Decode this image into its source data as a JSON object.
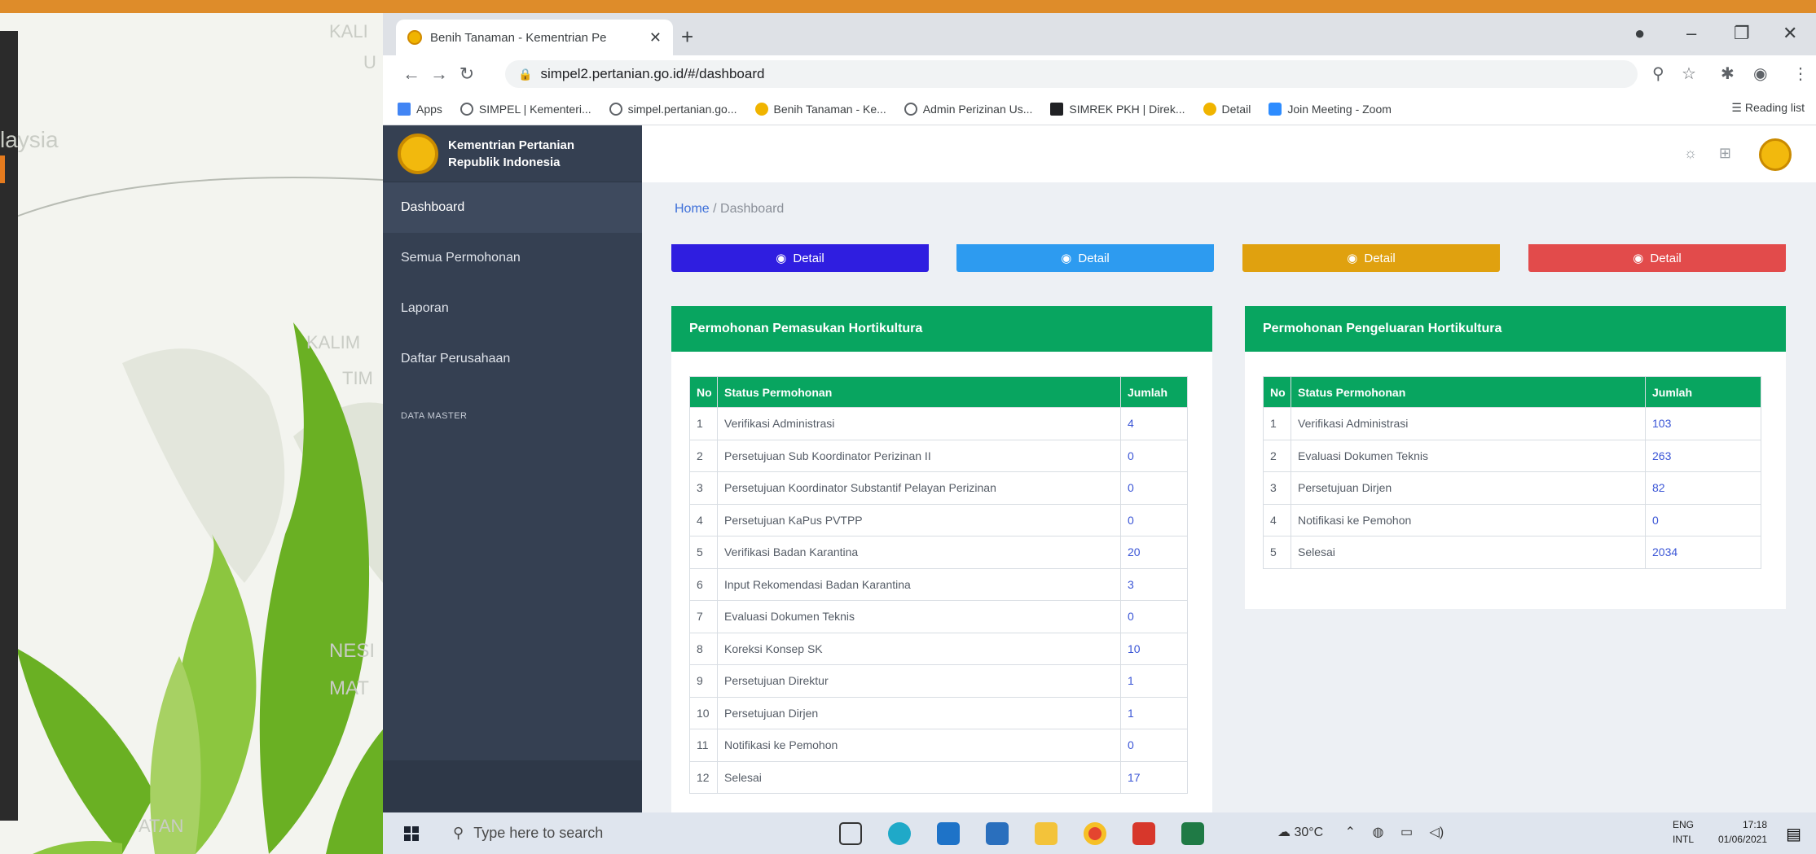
{
  "background": {
    "map_labels": [
      "laysia",
      "KALIM",
      "TIM",
      "NESI",
      "MAT",
      "ATAN",
      "KALI",
      "U"
    ]
  },
  "browser": {
    "tab_title": "Benih Tanaman - Kementrian Pe",
    "url": "simpel2.pertanian.go.id/#/dashboard",
    "bookmarks": [
      {
        "label": "Apps",
        "color": "#4285f4"
      },
      {
        "label": "SIMPEL | Kementeri...",
        "color": "#9aa0a6"
      },
      {
        "label": "simpel.pertanian.go...",
        "color": "#9aa0a6"
      },
      {
        "label": "Benih Tanaman - Ke...",
        "color": "#f0b400"
      },
      {
        "label": "Admin Perizinan Us...",
        "color": "#9aa0a6"
      },
      {
        "label": "SIMREK PKH | Direk...",
        "color": "#202124"
      },
      {
        "label": "Detail",
        "color": "#f0b400"
      },
      {
        "label": "Join Meeting - Zoom",
        "color": "#2d8cff"
      }
    ],
    "reading_list": "Reading list"
  },
  "app": {
    "brand_line1": "Kementrian Pertanian",
    "brand_line2": "Republik Indonesia",
    "nav": [
      "Dashboard",
      "Semua Permohonan",
      "Laporan",
      "Daftar Perusahaan"
    ],
    "nav_header": "DATA MASTER",
    "breadcrumb_home": "Home",
    "breadcrumb_sep": "/",
    "breadcrumb_current": "Dashboard",
    "detail_label": "Detail",
    "detail_colors": [
      "#2f1ee0",
      "#2d9bf0",
      "#e0a10f",
      "#e24b4b"
    ]
  },
  "card_left": {
    "title": "Permohonan Pemasukan Hortikultura",
    "col_no": "No",
    "col_status": "Status Permohonan",
    "col_jumlah": "Jumlah",
    "rows": [
      {
        "no": "1",
        "status": "Verifikasi Administrasi",
        "jumlah": "4"
      },
      {
        "no": "2",
        "status": "Persetujuan Sub Koordinator Perizinan II",
        "jumlah": "0"
      },
      {
        "no": "3",
        "status": "Persetujuan Koordinator Substantif Pelayan Perizinan",
        "jumlah": "0"
      },
      {
        "no": "4",
        "status": "Persetujuan KaPus PVTPP",
        "jumlah": "0"
      },
      {
        "no": "5",
        "status": "Verifikasi Badan Karantina",
        "jumlah": "20"
      },
      {
        "no": "6",
        "status": "Input Rekomendasi Badan Karantina",
        "jumlah": "3"
      },
      {
        "no": "7",
        "status": "Evaluasi Dokumen Teknis",
        "jumlah": "0"
      },
      {
        "no": "8",
        "status": "Koreksi Konsep SK",
        "jumlah": "10"
      },
      {
        "no": "9",
        "status": "Persetujuan Direktur",
        "jumlah": "1"
      },
      {
        "no": "10",
        "status": "Persetujuan Dirjen",
        "jumlah": "1"
      },
      {
        "no": "11",
        "status": "Notifikasi ke Pemohon",
        "jumlah": "0"
      },
      {
        "no": "12",
        "status": "Selesai",
        "jumlah": "17"
      }
    ]
  },
  "card_right": {
    "title": "Permohonan Pengeluaran Hortikultura",
    "col_no": "No",
    "col_status": "Status Permohonan",
    "col_jumlah": "Jumlah",
    "rows": [
      {
        "no": "1",
        "status": "Verifikasi Administrasi",
        "jumlah": "103"
      },
      {
        "no": "2",
        "status": "Evaluasi Dokumen Teknis",
        "jumlah": "263"
      },
      {
        "no": "3",
        "status": "Persetujuan Dirjen",
        "jumlah": "82"
      },
      {
        "no": "4",
        "status": "Notifikasi ke Pemohon",
        "jumlah": "0"
      },
      {
        "no": "5",
        "status": "Selesai",
        "jumlah": "2034"
      }
    ]
  },
  "taskbar": {
    "search_placeholder": "Type here to search",
    "weather": "30°C",
    "lang_top": "ENG",
    "lang_bottom": "INTL",
    "time": "17:18",
    "date": "01/06/2021"
  }
}
